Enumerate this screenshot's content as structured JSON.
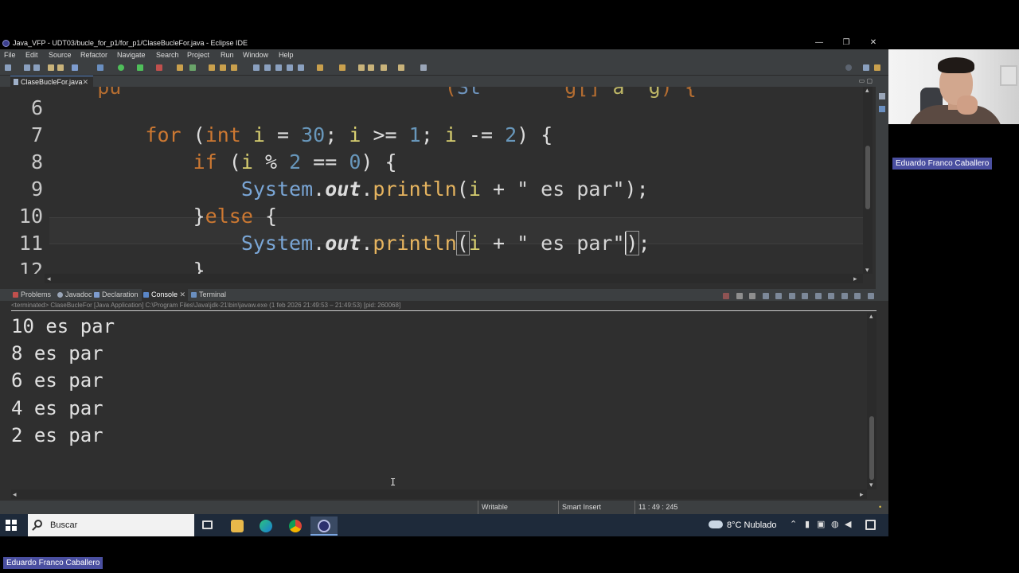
{
  "window": {
    "title": "Java_VFP - UDT03/bucle_for_p1/for_p1/ClaseBucleFor.java - Eclipse IDE",
    "min": "—",
    "max": "❐",
    "close": "✕"
  },
  "menu": [
    "File",
    "Edit",
    "Source",
    "Refactor",
    "Navigate",
    "Search",
    "Project",
    "Run",
    "Window",
    "Help"
  ],
  "editor": {
    "tab_label": "ClaseBucleFor.java",
    "tab_close": "✕",
    "line_numbers": [
      "6",
      "7",
      "8",
      "9",
      "10",
      "11",
      "12"
    ]
  },
  "console": {
    "tabs": [
      "Problems",
      "Javadoc",
      "Declaration",
      "Console",
      "Terminal"
    ],
    "active_tab": "Console",
    "status": "<terminated> ClaseBucleFor [Java Application] C:\\Program Files\\Java\\jdk-21\\bin\\javaw.exe  (1 feb 2026 21:49:53 – 21:49:53) [pid: 260068]",
    "output": [
      "10 es par",
      "8 es par",
      "6 es par",
      "4 es par",
      "2 es par"
    ]
  },
  "statusbar": {
    "writable": "Writable",
    "insert_mode": "Smart Insert",
    "position": "11 : 49 : 245"
  },
  "taskbar": {
    "search_placeholder": "Buscar",
    "weather": "8°C  Nublado"
  },
  "participant": {
    "name_top": "Eduardo Franco Caballero",
    "name_bottom": "Eduardo Franco Caballero"
  },
  "colors": {
    "keyword": "#cc7832",
    "number": "#6897bb",
    "variable": "#d8cf70",
    "method": "#e6b45f",
    "badge": "#4a4fa0"
  }
}
